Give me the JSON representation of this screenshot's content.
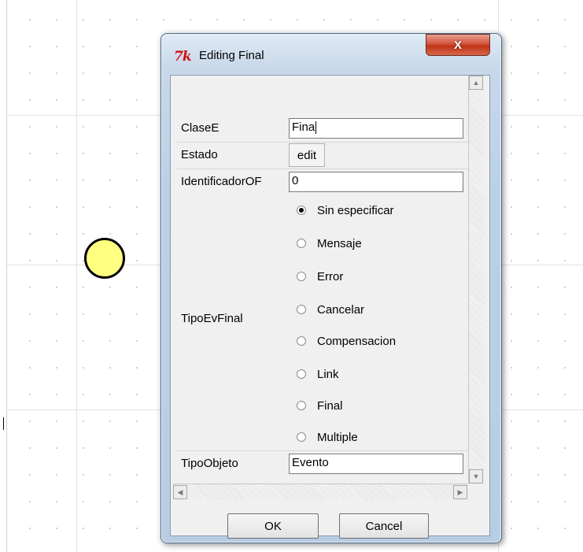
{
  "window": {
    "title": "Editing Final",
    "app_icon_text": "7k",
    "close_label": "X"
  },
  "form": {
    "rows": {
      "clase": {
        "label": "ClaseE",
        "value": "Fina"
      },
      "estado": {
        "label": "Estado",
        "button_label": "edit"
      },
      "identificador": {
        "label": "IdentificadorOF",
        "value": "0"
      },
      "tipo_ev_final": {
        "label": "TipoEvFinal",
        "selected": "Sin especificar",
        "options": [
          "Sin especificar",
          "Mensaje",
          "Error",
          "Cancelar",
          "Compensacion",
          "Link",
          "Final",
          "Multiple"
        ]
      },
      "tipo_objeto": {
        "label": "TipoObjeto",
        "value": "Evento"
      }
    }
  },
  "scroll": {
    "up_arrow": "▲",
    "down_arrow": "▼",
    "left_arrow": "◀",
    "right_arrow": "▶"
  },
  "buttons": {
    "ok": "OK",
    "cancel": "Cancel"
  },
  "colors": {
    "event_fill": "#ffff80",
    "close_button": "#c8442a",
    "window_frame": "#bcd0e5"
  }
}
